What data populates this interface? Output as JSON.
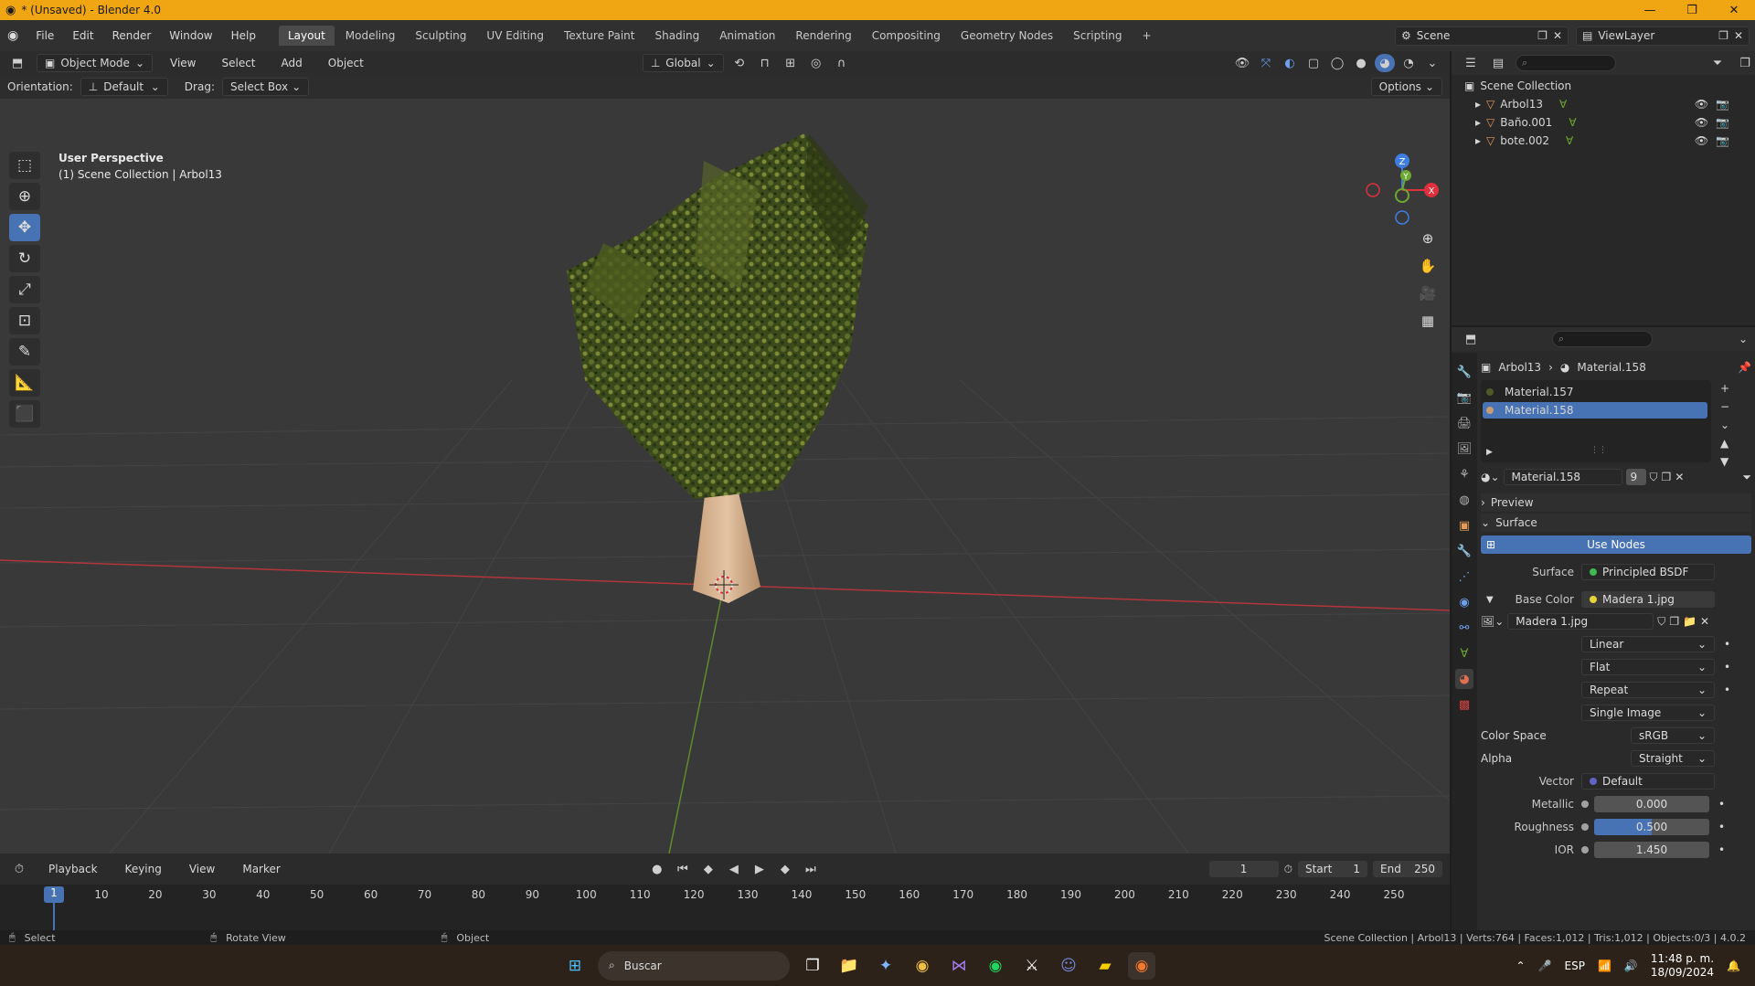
{
  "title_bar": {
    "title": "* (Unsaved) - Blender 4.0"
  },
  "menu": {
    "items": [
      "File",
      "Edit",
      "Render",
      "Window",
      "Help"
    ],
    "workspaces": [
      "Layout",
      "Modeling",
      "Sculpting",
      "UV Editing",
      "Texture Paint",
      "Shading",
      "Animation",
      "Rendering",
      "Compositing",
      "Geometry Nodes",
      "Scripting"
    ],
    "active_workspace": "Layout",
    "scene": "Scene",
    "view_layer": "ViewLayer"
  },
  "viewport": {
    "mode": "Object Mode",
    "menus": [
      "View",
      "Select",
      "Add",
      "Object"
    ],
    "transform": "Global",
    "orientation_label": "Orientation:",
    "orientation": "Default",
    "drag_label": "Drag:",
    "drag": "Select Box",
    "options": "Options",
    "info_line1": "User Perspective",
    "info_line2": "(1) Scene Collection | Arbol13",
    "gizmo": {
      "x": "X",
      "y": "Y",
      "z": "Z"
    }
  },
  "outliner": {
    "root": "Scene Collection",
    "items": [
      {
        "name": "Arbol13"
      },
      {
        "name": "Baño.001"
      },
      {
        "name": "bote.002"
      }
    ]
  },
  "properties": {
    "breadcrumb_object": "Arbol13",
    "breadcrumb_material": "Material.158",
    "material_slots": [
      "Material.157",
      "Material.158"
    ],
    "active_slot": "Material.158",
    "material_name": "Material.158",
    "user_count": "9",
    "preview_label": "Preview",
    "surface_label": "Surface",
    "use_nodes": "Use Nodes",
    "surface_field_label": "Surface",
    "surface_value": "Principled BSDF",
    "base_color_label": "Base Color",
    "base_color_value": "Madera 1.jpg",
    "image_name": "Madera 1.jpg",
    "interpolation": "Linear",
    "projection": "Flat",
    "extension": "Repeat",
    "source": "Single Image",
    "color_space_label": "Color Space",
    "color_space": "sRGB",
    "alpha_label": "Alpha",
    "alpha": "Straight",
    "vector_label": "Vector",
    "vector": "Default",
    "metallic_label": "Metallic",
    "metallic": "0.000",
    "roughness_label": "Roughness",
    "roughness": "0.500",
    "ior_label": "IOR",
    "ior": "1.450"
  },
  "timeline": {
    "menus": [
      "Playback",
      "Keying",
      "View",
      "Marker"
    ],
    "current_frame": "1",
    "start_label": "Start",
    "start": "1",
    "end_label": "End",
    "end": "250",
    "ticks": [
      "1",
      "10",
      "20",
      "30",
      "40",
      "50",
      "60",
      "70",
      "80",
      "90",
      "100",
      "110",
      "120",
      "130",
      "140",
      "150",
      "160",
      "170",
      "180",
      "190",
      "200",
      "210",
      "220",
      "230",
      "240",
      "250"
    ]
  },
  "status": {
    "select": "Select",
    "rotate": "Rotate View",
    "object": "Object",
    "stats": "Scene Collection | Arbol13 | Verts:764 | Faces:1,012 | Tris:1,012 | Objects:0/3 | 4.0.2"
  },
  "taskbar": {
    "search": "Buscar",
    "lang": "ESP",
    "time": "11:48 p. m.",
    "date": "18/09/2024"
  },
  "colors": {
    "accent": "#4772b3",
    "titlebar": "#f0a513",
    "axis_x": "#e0303e",
    "axis_y": "#6ca832",
    "axis_z": "#3f7ee0"
  }
}
